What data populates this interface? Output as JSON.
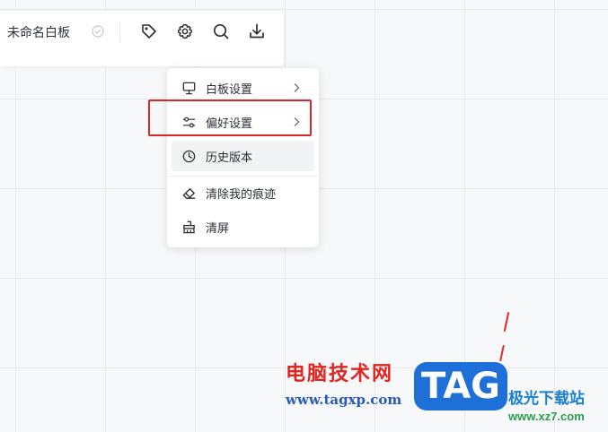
{
  "document": {
    "title": "未命名白板"
  },
  "toolbar": {
    "icons": [
      "tag-icon",
      "gear-icon",
      "search-icon",
      "download-icon"
    ]
  },
  "settings_menu": {
    "items": [
      {
        "label": "白板设置",
        "icon": "monitor-icon",
        "has_submenu": true
      },
      {
        "label": "偏好设置",
        "icon": "sliders-icon",
        "has_submenu": true,
        "highlighted": true
      },
      {
        "label": "历史版本",
        "icon": "clock-icon",
        "has_submenu": false,
        "hovered": true
      },
      {
        "label": "清除我的痕迹",
        "icon": "eraser-icon",
        "has_submenu": false
      },
      {
        "label": "清屏",
        "icon": "broom-icon",
        "has_submenu": false
      }
    ]
  },
  "watermark": {
    "left_title": "电脑技术网",
    "left_url": "www.tagxp.com",
    "badge": "TAG",
    "right_title": "极光下载站",
    "right_url": "www.xz7.com"
  },
  "colors": {
    "highlight_border": "#d9262b",
    "accent_blue": "#1f6fd9"
  }
}
